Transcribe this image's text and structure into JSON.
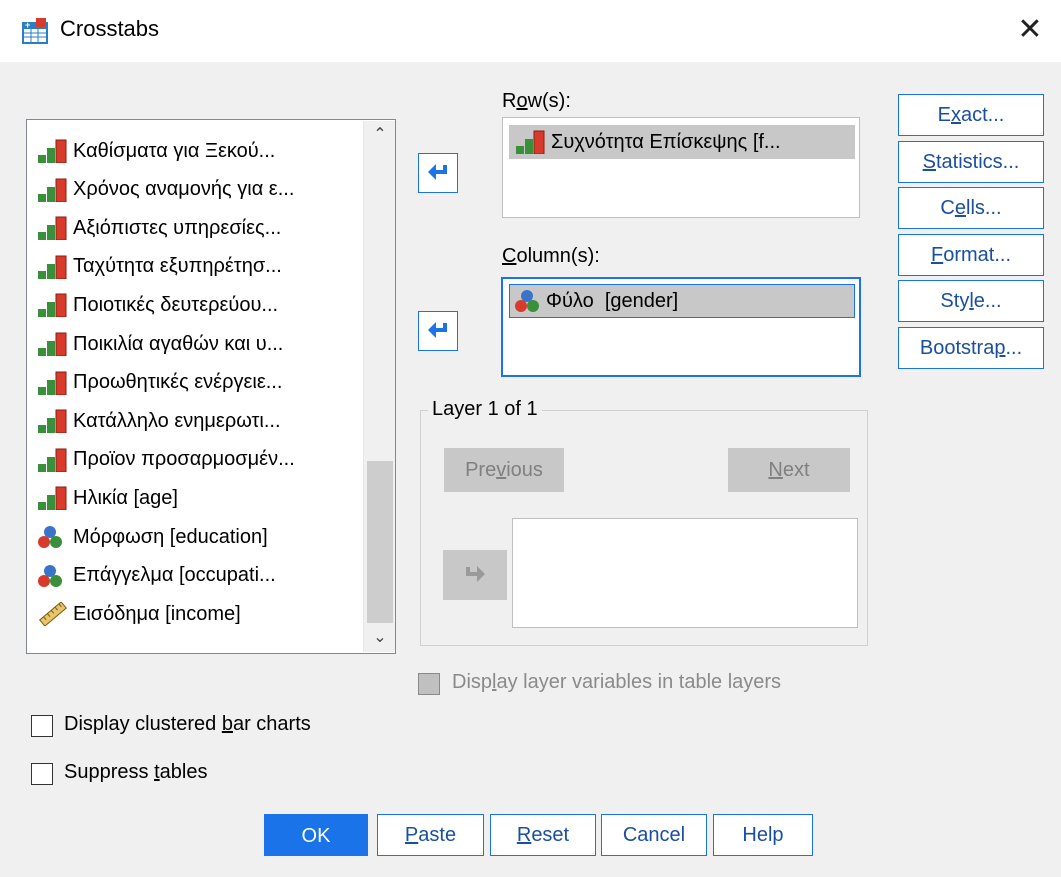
{
  "window": {
    "title": "Crosstabs"
  },
  "variables": [
    {
      "label": "Καθίσματα για Ξεκού...",
      "icon": "ordinal-bar-icon"
    },
    {
      "label": "Χρόνος αναμονής για ε...",
      "icon": "ordinal-bar-icon"
    },
    {
      "label": "Αξιόπιστες υπηρεσίες...",
      "icon": "ordinal-bar-icon"
    },
    {
      "label": "Ταχύτητα εξυπηρέτησ...",
      "icon": "ordinal-bar-icon"
    },
    {
      "label": "Ποιοτικές δευτερεύου...",
      "icon": "ordinal-bar-icon"
    },
    {
      "label": "Ποικιλία αγαθών και υ...",
      "icon": "ordinal-bar-icon"
    },
    {
      "label": "Προωθητικές ενέργειε...",
      "icon": "ordinal-bar-icon"
    },
    {
      "label": "Κατάλληλο ενημερωτι...",
      "icon": "ordinal-bar-icon"
    },
    {
      "label": "Προϊον προσαρμοσμέν...",
      "icon": "ordinal-bar-icon"
    },
    {
      "label": "Ηλικία [age]",
      "icon": "ordinal-bar-icon"
    },
    {
      "label": "Μόρφωση [education]",
      "icon": "nominal-circles-icon"
    },
    {
      "label": "Επάγγελμα [occupati...",
      "icon": "nominal-circles-icon"
    },
    {
      "label": "Εισόδημα [income]",
      "icon": "scale-ruler-icon"
    }
  ],
  "rows": {
    "label_prefix": "R",
    "label_ul": "o",
    "label_suffix": "w(s):",
    "items": [
      {
        "label": "Συχνότητα Επίσκεψης [f...",
        "icon": "ordinal-bar-icon"
      }
    ]
  },
  "columns": {
    "label_prefix": "",
    "label_ul": "C",
    "label_suffix": "olumn(s):",
    "items": [
      {
        "label": "Φύλο  [gender]",
        "icon": "nominal-circles-icon"
      }
    ]
  },
  "layer": {
    "title": "Layer 1 of 1",
    "previous": {
      "pre": "Pre",
      "ul": "v",
      "post": "ious"
    },
    "next": {
      "pre": "",
      "ul": "N",
      "post": "ext"
    },
    "display_layer": {
      "pre": "Disp",
      "ul": "l",
      "post": "ay layer variables in table layers",
      "checked": false,
      "enabled": false
    }
  },
  "side_buttons": [
    {
      "pre": "E",
      "ul": "x",
      "post": "act..."
    },
    {
      "pre": "",
      "ul": "S",
      "post": "tatistics..."
    },
    {
      "pre": "C",
      "ul": "e",
      "post": "lls..."
    },
    {
      "pre": "",
      "ul": "F",
      "post": "ormat..."
    },
    {
      "pre": "Sty",
      "ul": "l",
      "post": "e..."
    },
    {
      "pre": "Bootstra",
      "ul": "p",
      "post": "..."
    }
  ],
  "options": {
    "clustered": {
      "pre": "Display clustered ",
      "ul": "b",
      "post": "ar charts",
      "checked": false
    },
    "suppress": {
      "pre": "Suppress ",
      "ul": "t",
      "post": "ables",
      "checked": false
    }
  },
  "dialog_buttons": {
    "ok": "OK",
    "paste": {
      "pre": "",
      "ul": "P",
      "post": "aste"
    },
    "reset": {
      "pre": "",
      "ul": "R",
      "post": "eset"
    },
    "cancel": "Cancel",
    "help": "Help"
  },
  "colors": {
    "accent": "#1a73e8",
    "bar_red": "#d83b2b",
    "bar_green": "#3a8f3a",
    "selection": "#c8c8c8"
  }
}
